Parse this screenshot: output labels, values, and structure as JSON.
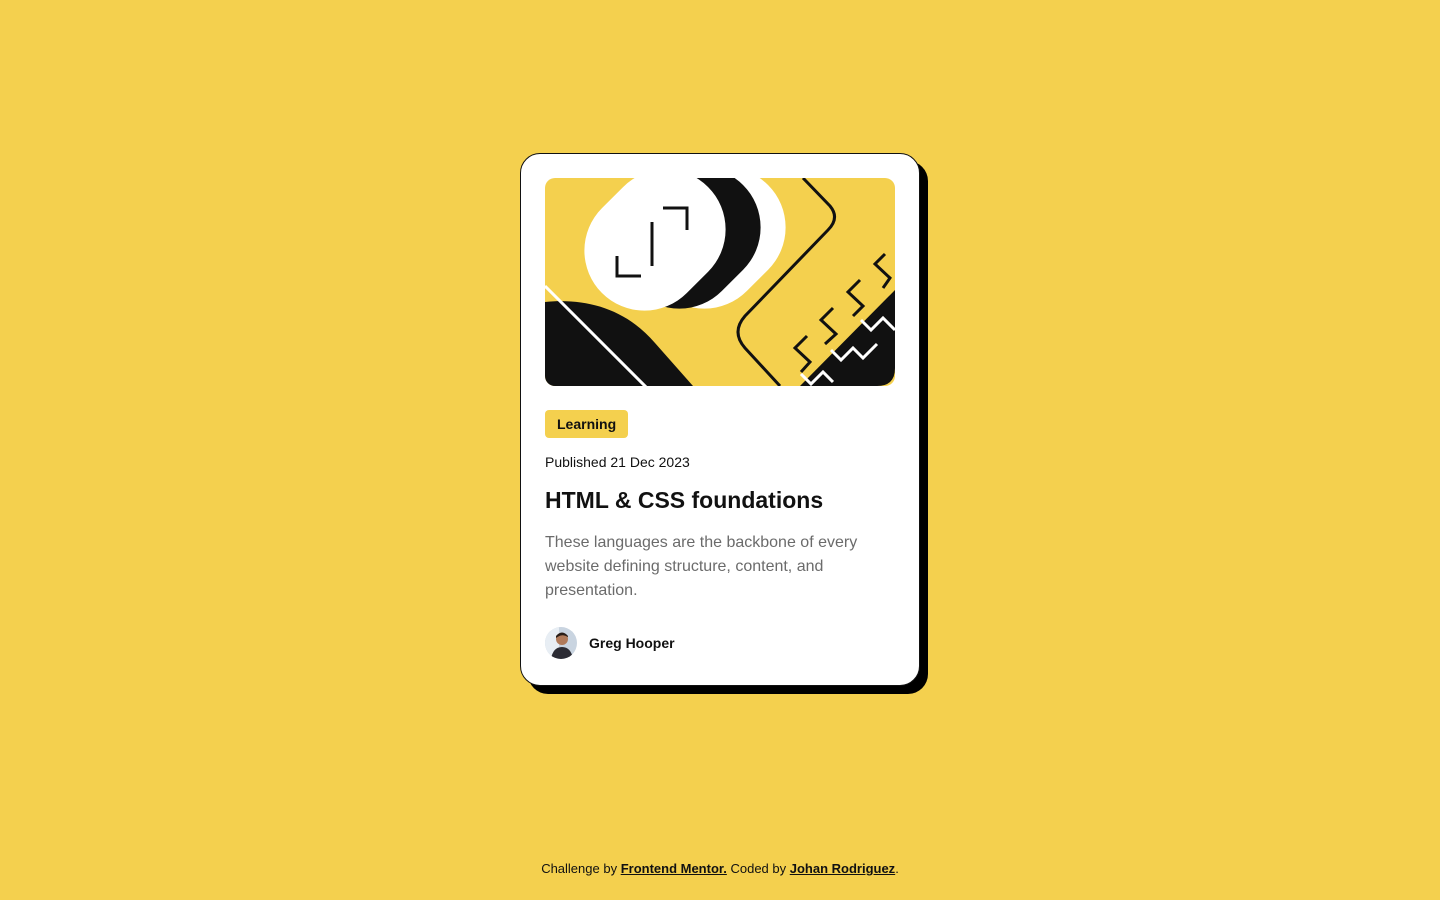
{
  "card": {
    "hero_image": "html-css-illustration",
    "tag": "Learning",
    "published": "Published 21 Dec 2023",
    "title": "HTML & CSS foundations",
    "description": "These languages are the backbone of every website defining structure, content, and presentation.",
    "author": {
      "name": "Greg Hooper",
      "avatar": "author-avatar"
    }
  },
  "footer": {
    "prefix": "Challenge by ",
    "link1": "Frontend Mentor.",
    "middle": " Coded by ",
    "link2": "Johan Rodriguez",
    "suffix": "."
  },
  "colors": {
    "background": "#f4d04e",
    "card": "#ffffff",
    "text": "#111111",
    "muted": "#6b6b6b"
  }
}
